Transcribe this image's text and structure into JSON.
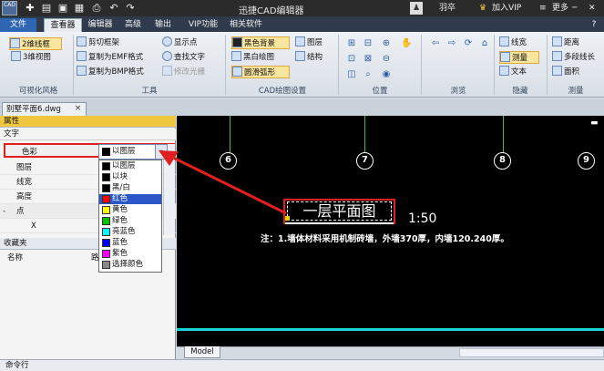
{
  "app": {
    "title": "迅捷CAD编辑器",
    "logo": "CAD",
    "user": "羽卒",
    "vip": "加入VIP",
    "more": "更多"
  },
  "tabs": [
    {
      "label": "文件"
    },
    {
      "label": "查看器"
    },
    {
      "label": "编辑器"
    },
    {
      "label": "高级"
    },
    {
      "label": "输出"
    },
    {
      "label": "VIP功能"
    },
    {
      "label": "相关软件"
    }
  ],
  "ribbon": {
    "groups": {
      "visual": {
        "label": "可视化风格",
        "items": [
          "2维线框",
          "3维视图"
        ]
      },
      "tools": {
        "label": "工具",
        "items": [
          "剪切框架",
          "复制为EMF格式",
          "复制为BMP格式",
          "显示点",
          "查找文字",
          "修改光栅"
        ]
      },
      "cad": {
        "label": "CAD绘图设置",
        "items": [
          "黑色背景",
          "黑白绘图",
          "圆滑弧形",
          "图层",
          "结构"
        ]
      },
      "position": {
        "label": "位置"
      },
      "browse": {
        "label": "浏览"
      },
      "hide": {
        "label": "隐藏",
        "items": [
          "线宽",
          "测量",
          "文本"
        ]
      },
      "measure": {
        "label": "测量",
        "items": [
          "距离",
          "多段线长",
          "面积"
        ]
      }
    }
  },
  "document": {
    "tab_label": "别墅平面6.dwg",
    "close": "×"
  },
  "properties": {
    "header": "属性",
    "section_text": "文字",
    "rows": [
      {
        "label": "色彩",
        "value": "以图层"
      },
      {
        "label": "图层"
      },
      {
        "label": "线宽"
      },
      {
        "label": "高度"
      }
    ],
    "section_point": "点",
    "x_label": "X",
    "point_toggle": "-"
  },
  "color_dropdown": {
    "options": [
      {
        "label": "以图层",
        "color": "#000000"
      },
      {
        "label": "以块",
        "color": "#000000"
      },
      {
        "label": "黑/白",
        "color": "#000000"
      },
      {
        "label": "红色",
        "color": "#ff0000"
      },
      {
        "label": "黄色",
        "color": "#ffff00"
      },
      {
        "label": "绿色",
        "color": "#00c000"
      },
      {
        "label": "亮蓝色",
        "color": "#00ffff"
      },
      {
        "label": "蓝色",
        "color": "#0000ff"
      },
      {
        "label": "紫色",
        "color": "#ff00ff"
      },
      {
        "label": "选择颜色",
        "color": "#888888"
      }
    ],
    "highlighted": 3
  },
  "favorites": {
    "header": "收藏夹",
    "col_name": "名称",
    "col_path": "路"
  },
  "drawing": {
    "axes": [
      "6",
      "7",
      "8",
      "9"
    ],
    "title": "一层平面图",
    "scale": "1:50",
    "note": "注：1.墙体材料采用机制砖墙，外墙370厚，内墙120.240厚。"
  },
  "model_tab": "Model",
  "command_line": "命令行"
}
